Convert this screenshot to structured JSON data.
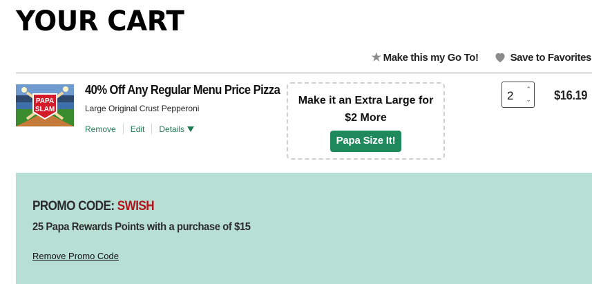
{
  "header": {
    "title": "YOUR CART"
  },
  "actions": {
    "go_to_label": "Make this my Go To!",
    "favorites_label": "Save to Favorites"
  },
  "item": {
    "thumbnail_text_top": "PAPA",
    "thumbnail_text_bottom": "SLAM",
    "name": "40% Off Any Regular Menu Price Pizza",
    "description": "Large Original Crust Pepperoni",
    "links": {
      "remove": "Remove",
      "edit": "Edit",
      "details": "Details"
    },
    "upsell": {
      "line1": "Make it an Extra Large for",
      "line2": "$2 More",
      "button": "Papa Size It!"
    },
    "quantity": "2",
    "price": "$16.19"
  },
  "promo": {
    "label": "PROMO CODE:",
    "code": "SWISH",
    "description": "25 Papa Rewards Points with a purchase of $15",
    "remove_label": "Remove Promo Code"
  },
  "colors": {
    "accent_green": "#1e8a5c",
    "promo_bg": "#b8dfd3",
    "promo_code_red": "#b5121b"
  }
}
